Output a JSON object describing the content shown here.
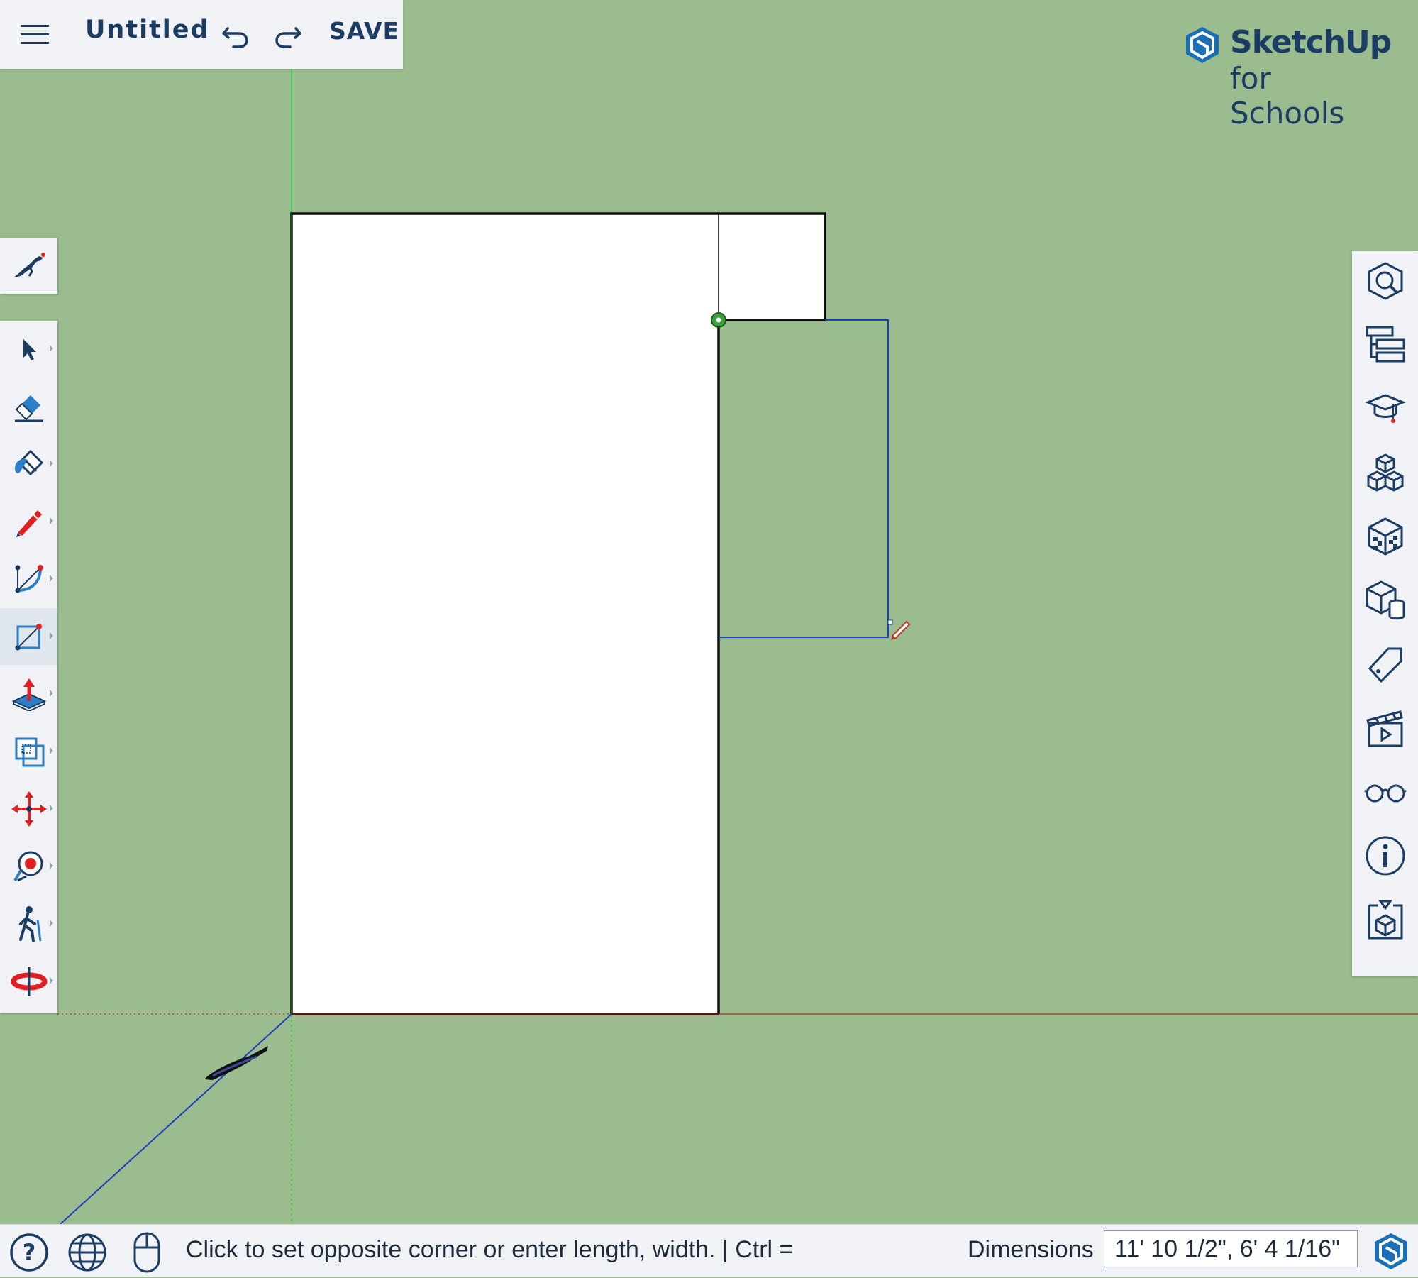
{
  "topbar": {
    "title": "Untitled",
    "save_label": "SAVE"
  },
  "logo": {
    "name": "SketchUp",
    "subtitle": "for Schools"
  },
  "left_toolbar": {
    "instructor": "instructor-icon",
    "tools": [
      {
        "name": "select",
        "icon": "cursor-arrow-icon"
      },
      {
        "name": "eraser",
        "icon": "eraser-icon"
      },
      {
        "name": "paint-bucket",
        "icon": "paint-bucket-icon"
      },
      {
        "name": "pencil",
        "icon": "pencil-icon"
      },
      {
        "name": "arc",
        "icon": "arc-icon"
      },
      {
        "name": "rectangle",
        "icon": "rectangle-icon",
        "active": true
      },
      {
        "name": "push-pull",
        "icon": "push-pull-icon"
      },
      {
        "name": "offset",
        "icon": "offset-icon"
      },
      {
        "name": "move",
        "icon": "move-icon"
      },
      {
        "name": "tape-measure",
        "icon": "tape-measure-icon"
      },
      {
        "name": "walk",
        "icon": "walk-icon"
      },
      {
        "name": "orbit",
        "icon": "orbit-icon"
      }
    ]
  },
  "right_toolbar": {
    "panels": [
      "entity-info-icon",
      "outliner-icon",
      "instructor-cap-icon",
      "components-icon",
      "materials-icon",
      "styles-icon",
      "tags-icon",
      "scenes-icon",
      "display-glasses-icon",
      "model-info-icon",
      "3d-warehouse-icon"
    ]
  },
  "statusbar": {
    "message": "Click to set opposite corner or enter length, width.  | Ctrl =",
    "dimensions_label": "Dimensions",
    "dimensions_value": "11' 10 1/2\", 6' 4 1/16\""
  },
  "colors": {
    "background": "#9bbc8f",
    "ui_panel": "#f1f2f5",
    "brand": "#1c3d63",
    "axis_red": "#c0392b",
    "axis_green": "#2ecc40",
    "axis_blue": "#1a3fc0"
  }
}
